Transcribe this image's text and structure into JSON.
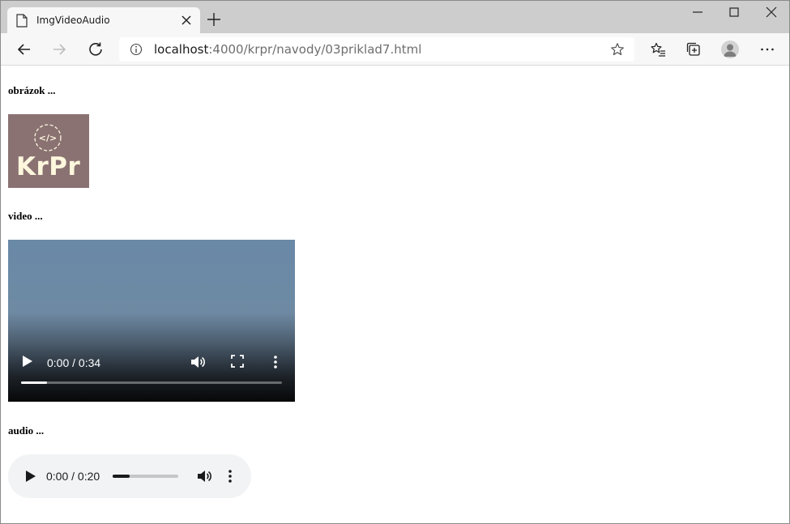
{
  "browser": {
    "tab_title": "ImgVideoAudio",
    "url_host": "localhost",
    "url_rest": ":4000/krpr/navody/03priklad7.html"
  },
  "page": {
    "image_heading": "obrázok ...",
    "video_heading": "video ...",
    "audio_heading": "audio ..."
  },
  "logo": {
    "text": "KrPr",
    "glyph": "</>",
    "background": "#8a7273",
    "text_color": "#fdf7dd"
  },
  "video": {
    "time": "0:00 / 0:34",
    "progress_fraction": 0.1,
    "icons": [
      "play-icon",
      "volume-icon",
      "fullscreen-icon",
      "more-options-icon"
    ]
  },
  "audio": {
    "time": "0:00 / 0:20",
    "progress_fraction": 0.26,
    "icons": [
      "play-icon",
      "volume-icon",
      "more-options-icon"
    ]
  },
  "colors": {
    "tabstrip": "#cdcdcd",
    "toolbar": "#f7f7f7",
    "audio_bg": "#f1f3f4"
  }
}
